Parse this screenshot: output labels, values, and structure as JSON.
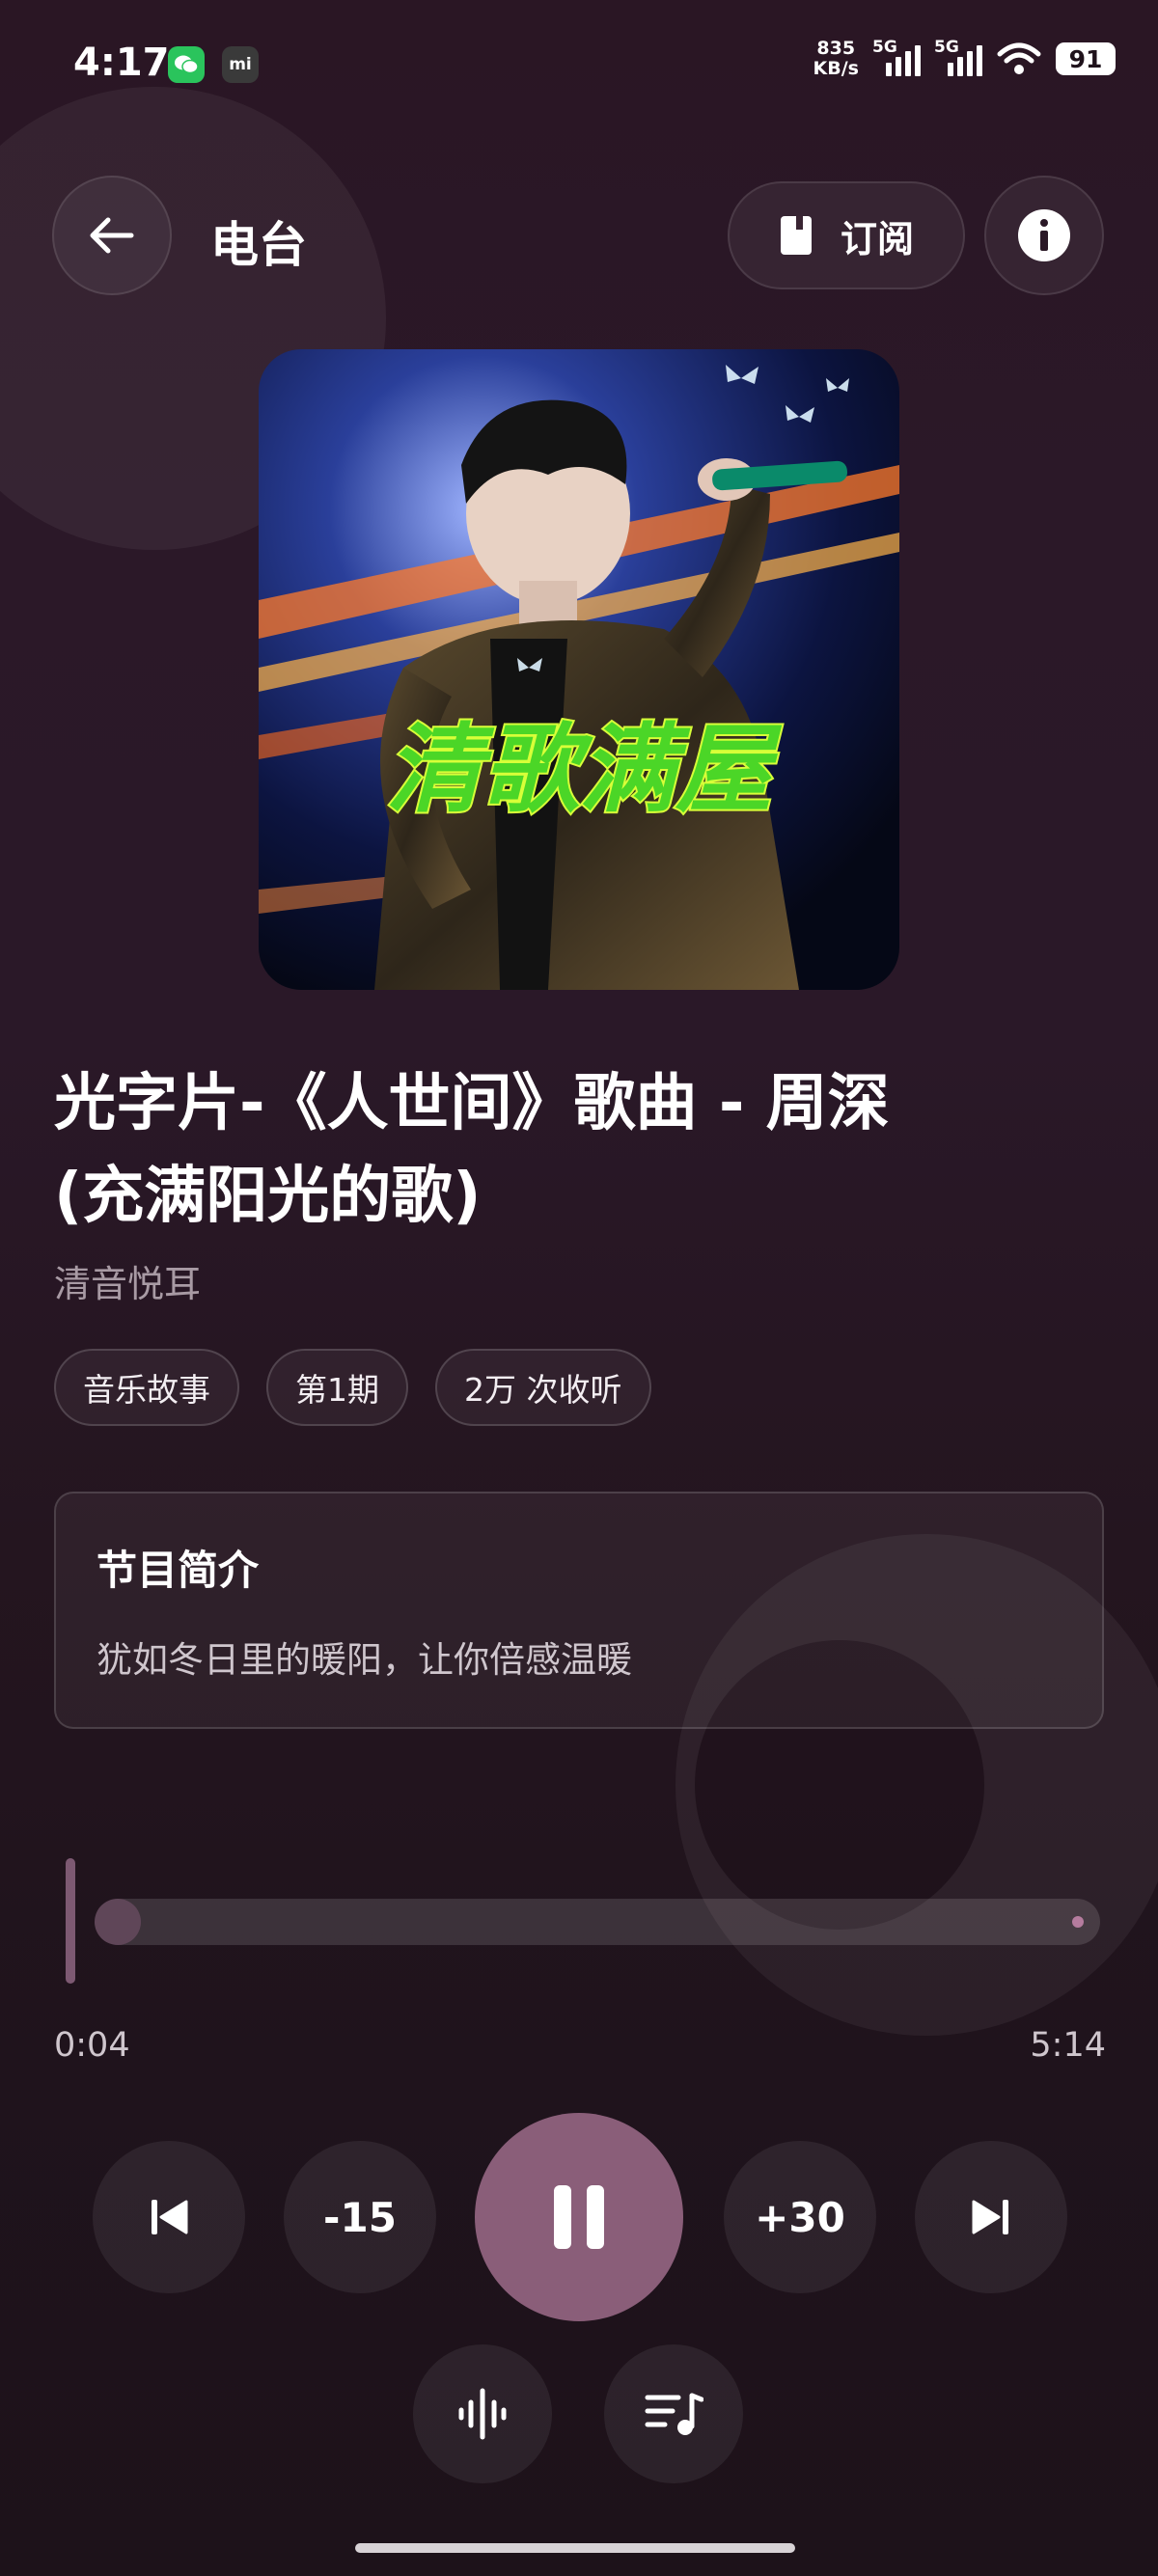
{
  "status_bar": {
    "time": "4:17",
    "net_speed_value": "835",
    "net_speed_unit": "KB/s",
    "signal1_label": "5G",
    "signal2_label": "5G",
    "battery": "91",
    "app_icons": [
      "wechat-icon",
      "mi-icon"
    ]
  },
  "header": {
    "title": "电台",
    "subscribe_label": "订阅",
    "icons": [
      "back-arrow-icon",
      "bookmark-icon",
      "info-icon"
    ]
  },
  "cover": {
    "overlay_text": "清歌满屋"
  },
  "track": {
    "title_line1": "光字片-《人世间》歌曲 - 周深",
    "title_line2": "(充满阳光的歌)",
    "author": "清音悦耳"
  },
  "chips": [
    "音乐故事",
    "第1期",
    "2万 次收听"
  ],
  "intro": {
    "heading": "节目简介",
    "text": "犹如冬日里的暖阳，让你倍感温暖"
  },
  "player": {
    "current_time": "0:04",
    "total_time": "5:14",
    "progress_fraction": 0.013,
    "rewind_label": "-15",
    "forward_label": "+30",
    "state": "playing"
  },
  "colors": {
    "accent": "#8a5e79",
    "background_top": "#2a1624",
    "background_bottom": "#1d121a",
    "muted_text": "#a89aa4"
  }
}
